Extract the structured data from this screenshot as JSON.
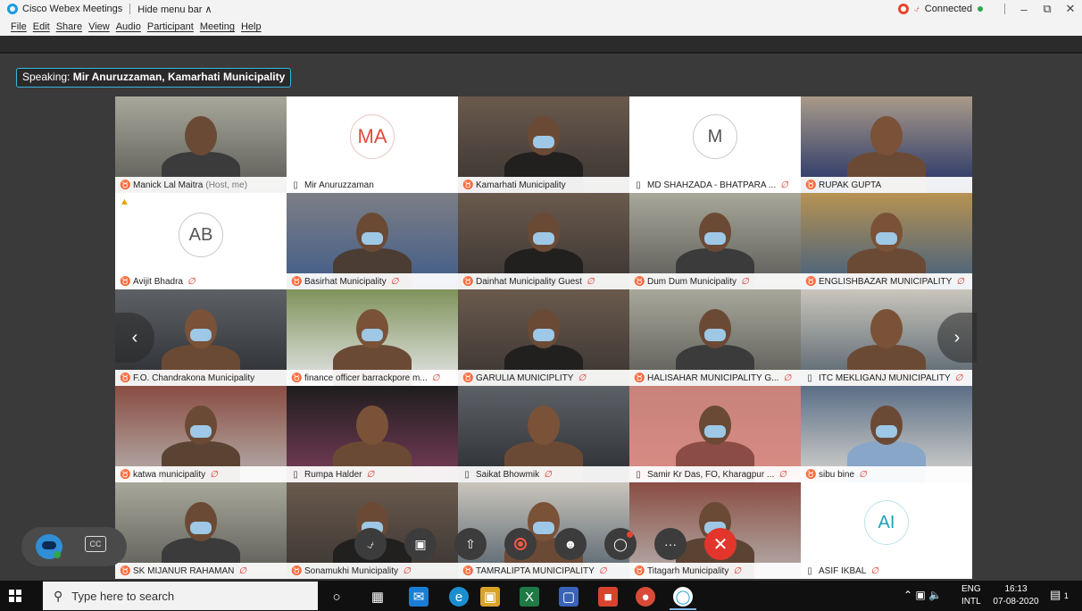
{
  "window": {
    "app_title": "Cisco Webex Meetings",
    "hide_menu_label": "Hide menu bar ∧",
    "connection_status": "Connected",
    "minimize": "–",
    "restore": "⧉",
    "close": "✕"
  },
  "menu": [
    "File",
    "Edit",
    "Share",
    "View",
    "Audio",
    "Participant",
    "Meeting",
    "Help"
  ],
  "speaking": {
    "prefix": "Speaking:",
    "name": "Mir Anuruzzaman, Kamarhati Municipality"
  },
  "participants": [
    {
      "name": "Manick Lal Maitra",
      "host_label": "(Host, me)",
      "device": "phone",
      "muted": false,
      "kind": "video",
      "scene": "office"
    },
    {
      "name": "Mir Anuruzzaman",
      "device": "desktop",
      "muted": false,
      "kind": "avatar",
      "initials": "MA"
    },
    {
      "name": "Kamarhati Municipality",
      "device": "phone",
      "muted": false,
      "kind": "video",
      "scene": "room",
      "active": true
    },
    {
      "name": "MD SHAHZADA - BHATPARA ...",
      "device": "desktop",
      "muted": true,
      "kind": "avatar",
      "initials": "M"
    },
    {
      "name": "RUPAK GUPTA",
      "device": "phone",
      "muted": false,
      "kind": "video",
      "scene": "wall"
    },
    {
      "name": "Avijit Bhadra",
      "device": "phone",
      "muted": true,
      "kind": "avatar",
      "initials": "AB",
      "warning": true
    },
    {
      "name": "Basirhat Municipality",
      "device": "phone",
      "muted": true,
      "kind": "video",
      "scene": "blinds"
    },
    {
      "name": "Dainhat Municipality Guest",
      "device": "phone",
      "muted": true,
      "kind": "video",
      "scene": "room"
    },
    {
      "name": "Dum Dum Municipality",
      "device": "phone",
      "muted": true,
      "kind": "video",
      "scene": "office"
    },
    {
      "name": "ENGLISHBAZAR MUNICIPALITY",
      "device": "phone",
      "muted": true,
      "kind": "video",
      "scene": "yellow"
    },
    {
      "name": "F.O. Chandrakona Municipality",
      "device": "phone",
      "muted": false,
      "kind": "video",
      "scene": "dim"
    },
    {
      "name": "finance officer barrackpore m...",
      "device": "phone",
      "muted": true,
      "kind": "video",
      "scene": "green"
    },
    {
      "name": "GARULIA MUNICIPLITY",
      "device": "phone",
      "muted": true,
      "kind": "video",
      "scene": "room"
    },
    {
      "name": "HALISAHAR MUNICIPALITY G...",
      "device": "phone",
      "muted": true,
      "kind": "video",
      "scene": "office"
    },
    {
      "name": "ITC MEKLIGANJ MUNICIPALITY",
      "device": "desktop",
      "muted": true,
      "kind": "video",
      "scene": "light"
    },
    {
      "name": "katwa municipality",
      "device": "phone",
      "muted": true,
      "kind": "video",
      "scene": "red"
    },
    {
      "name": "Rumpa Halder",
      "device": "desktop",
      "muted": true,
      "kind": "video",
      "scene": "dark"
    },
    {
      "name": "Saikat Bhowmik",
      "device": "desktop",
      "muted": true,
      "kind": "video",
      "scene": "dim"
    },
    {
      "name": "Samir Kr Das, FO, Kharagpur ...",
      "device": "desktop",
      "muted": true,
      "kind": "video",
      "scene": "curtain"
    },
    {
      "name": "sibu bine",
      "device": "phone",
      "muted": true,
      "kind": "video",
      "scene": "ceiling"
    },
    {
      "name": "SK MIJANUR RAHAMAN",
      "device": "phone",
      "muted": true,
      "kind": "video",
      "scene": "office"
    },
    {
      "name": "Sonamukhi Municipality",
      "device": "phone",
      "muted": true,
      "kind": "video",
      "scene": "room"
    },
    {
      "name": "TAMRALIPTA MUNICIPALITY",
      "device": "phone",
      "muted": true,
      "kind": "video",
      "scene": "light"
    },
    {
      "name": "Titagarh Municipality",
      "device": "phone",
      "muted": true,
      "kind": "video",
      "scene": "red"
    },
    {
      "name": "ASIF IKBAL",
      "device": "desktop",
      "muted": true,
      "kind": "avatar",
      "initials": "AI"
    }
  ],
  "navigation": {
    "prev": "‹",
    "next": "›"
  },
  "controls": {
    "cc_label": "CC",
    "more_label": "···",
    "end_label": "✕"
  },
  "taskbar": {
    "search_placeholder": "Type here to search",
    "language_top": "ENG",
    "language_bottom": "INTL",
    "time": "16:13",
    "date": "07-08-2020",
    "notification_count": "1"
  },
  "colors": {
    "accent": "#34b6e0",
    "muted_icon": "#d9342b",
    "end_call": "#e2352b",
    "connected": "#2ea84a"
  }
}
